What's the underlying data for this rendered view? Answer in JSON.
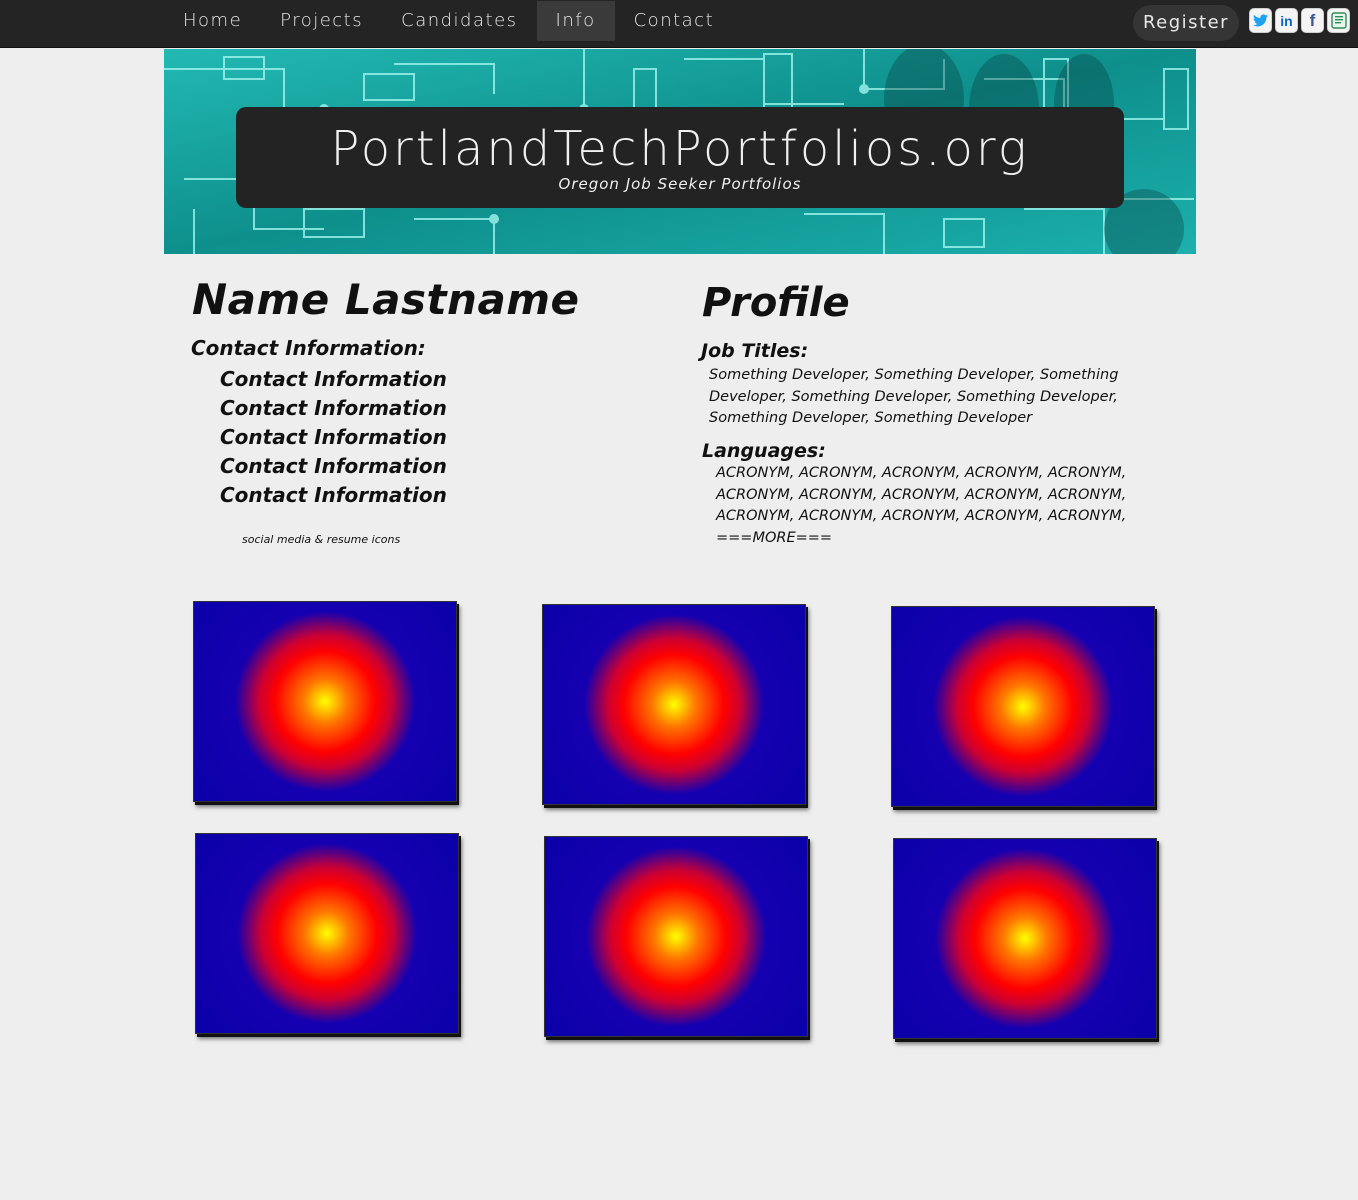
{
  "nav": {
    "items": [
      {
        "label": "Home",
        "active": false
      },
      {
        "label": "Projects",
        "active": false
      },
      {
        "label": "Candidates",
        "active": false
      },
      {
        "label": "Info",
        "active": true
      },
      {
        "label": "Contact",
        "active": false
      }
    ],
    "register_label": "Register",
    "social_icons": [
      "twitter-icon",
      "linkedin-icon",
      "facebook-icon",
      "resume-icon"
    ]
  },
  "banner": {
    "title": "PortlandTechPortfolios.org",
    "subtitle": "Oregon Job Seeker Portfolios"
  },
  "candidate": {
    "name": "Name Lastname",
    "contact_heading": "Contact Information:",
    "contact_lines": [
      "Contact Information",
      "Contact Information",
      "Contact Information",
      "Contact Information",
      "Contact Information"
    ],
    "social_note": "social media & resume icons"
  },
  "profile": {
    "heading": "Profile",
    "job_titles_heading": "Job Titles:",
    "job_titles_text": "Something Developer, Something Developer, Something Developer, Something Developer, Something Developer, Something Developer, Something Developer",
    "languages_heading": "Languages:",
    "languages_text": "ACRONYM, ACRONYM, ACRONYM, ACRONYM, ACRONYM, ACRONYM, ACRONYM, ACRONYM, ACRONYM, ACRONYM, ACRONYM, ACRONYM, ACRONYM, ACRONYM, ACRONYM, ===MORE==="
  },
  "colors": {
    "topbar": "#242424",
    "banner_teal": "#18a6a2",
    "tile_blue": "#0a00a8",
    "tile_center": "#ffff00"
  },
  "project_tile_count": 6
}
